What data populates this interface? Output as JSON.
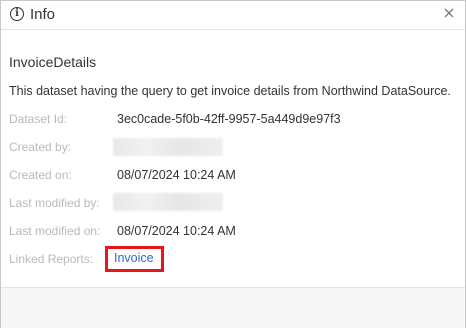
{
  "window": {
    "title": "Info",
    "title_icon": "info-icon",
    "close_icon": "close-icon"
  },
  "dataset": {
    "name": "InvoiceDetails",
    "description": "This dataset having the query to get invoice details from Northwind DataSource."
  },
  "fields": {
    "dataset_id_label": "Dataset Id:",
    "dataset_id_value": "3ec0cade-5f0b-42ff-9957-5a449d9e97f3",
    "created_by_label": "Created by:",
    "created_on_label": "Created on:",
    "created_on_value": "08/07/2024 10:24 AM",
    "last_modified_by_label": "Last modified by:",
    "last_modified_on_label": "Last modified on:",
    "last_modified_on_value": "08/07/2024 10:24 AM",
    "linked_reports_label": "Linked Reports:",
    "linked_report_value": "Invoice"
  },
  "colors": {
    "label_gray": "#b9b9b9",
    "link_blue": "#2a6bd8",
    "highlight_red": "#e8161b"
  }
}
